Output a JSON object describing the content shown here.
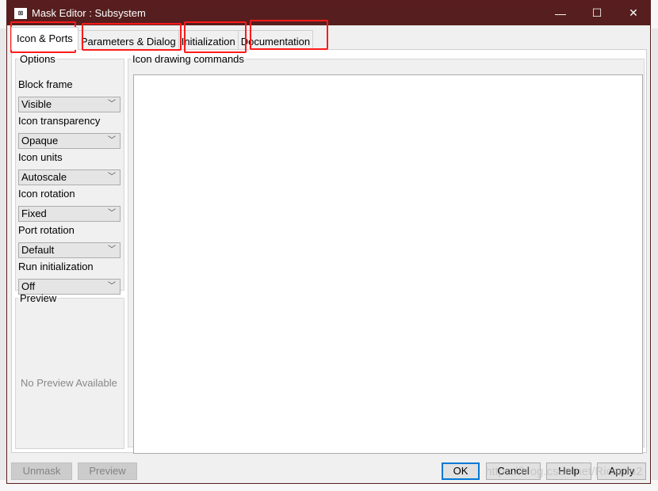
{
  "window": {
    "title": "Mask Editor : Subsystem",
    "minimize": "—",
    "maximize": "☐",
    "close": "✕"
  },
  "tabs": [
    {
      "label": "Icon & Ports",
      "active": true
    },
    {
      "label": "Parameters & Dialog"
    },
    {
      "label": "Initialization"
    },
    {
      "label": "Documentation"
    }
  ],
  "highlight_color": "#ff1a1a",
  "options": {
    "legend": "Options",
    "fields": [
      {
        "label": "Block frame",
        "value": "Visible"
      },
      {
        "label": "Icon transparency",
        "value": "Opaque"
      },
      {
        "label": "Icon units",
        "value": "Autoscale"
      },
      {
        "label": "Icon rotation",
        "value": "Fixed"
      },
      {
        "label": "Port rotation",
        "value": "Default"
      },
      {
        "label": "Run initialization",
        "value": "Off"
      }
    ]
  },
  "preview": {
    "legend": "Preview",
    "empty_text": "No Preview Available"
  },
  "commands": {
    "legend": "Icon drawing commands",
    "value": ""
  },
  "buttons": {
    "unmask": "Unmask",
    "preview": "Preview",
    "ok": "OK",
    "cancel": "Cancel",
    "help": "Help",
    "apply": "Apply"
  },
  "watermark": "https://blog.csdn.net/Ricardo2"
}
